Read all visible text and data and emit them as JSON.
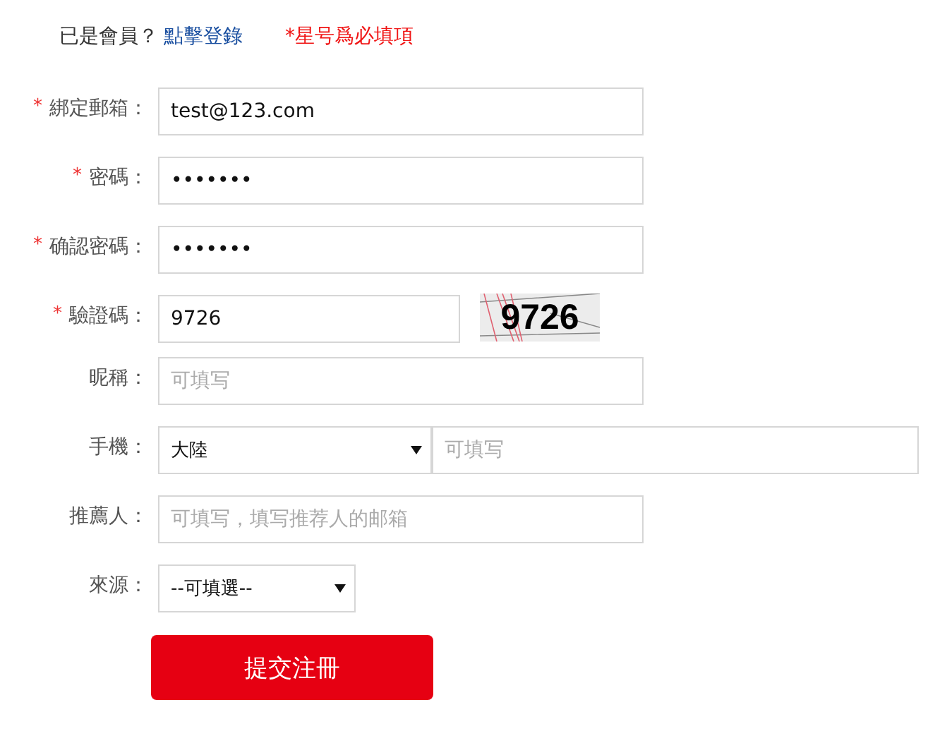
{
  "header": {
    "prompt": "已是會員？",
    "login_link": "點擊登錄",
    "required_note": "*星号爲必填項"
  },
  "fields": [
    {
      "kind": "text",
      "required_mark": "*",
      "label": "綁定郵箱：",
      "value": "test@123.com"
    },
    {
      "kind": "text",
      "required_mark": "*",
      "label": "密碼：",
      "value": "•••••••"
    },
    {
      "kind": "text",
      "required_mark": "*",
      "label": "确認密碼：",
      "value": "•••••••"
    },
    {
      "kind": "captcha",
      "required_mark": "*",
      "label": "驗證碼：",
      "value": "9726",
      "captcha_text": "9726"
    },
    {
      "kind": "text",
      "label": "昵稱：",
      "placeholder": "可填写"
    },
    {
      "kind": "phone",
      "label": "手機：",
      "select_value": "大陸",
      "placeholder": "可填写"
    },
    {
      "kind": "text",
      "label": "推薦人：",
      "placeholder": "可填写，填写推荐人的邮箱"
    },
    {
      "kind": "select",
      "label": "來源：",
      "select_value": "--可填選--"
    }
  ],
  "submit": "提交注冊"
}
